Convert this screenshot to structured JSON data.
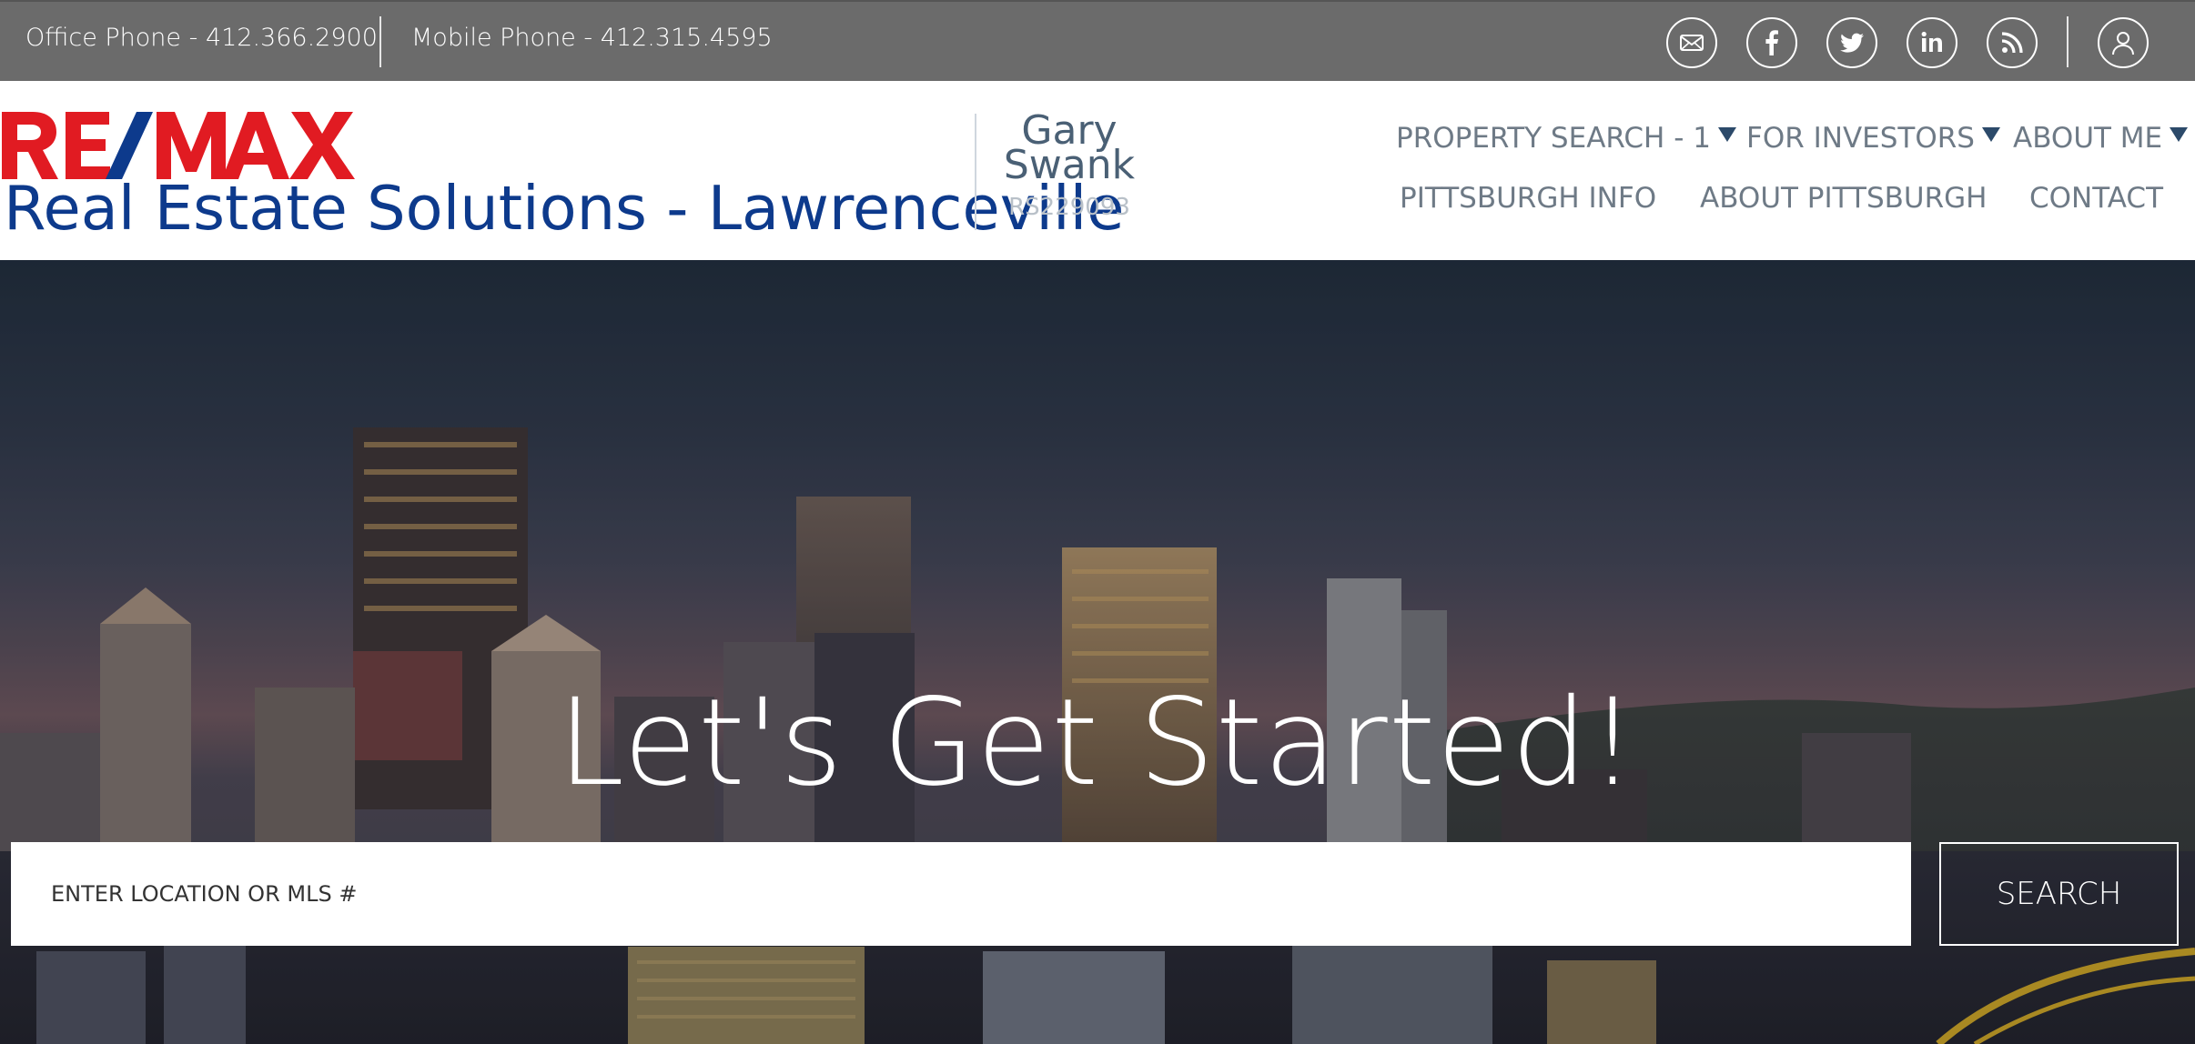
{
  "topbar": {
    "office_phone": "Office Phone - 412.366.2900",
    "mobile_phone": "Mobile Phone - 412.315.4595",
    "icons": [
      "email-icon",
      "facebook-icon",
      "twitter-icon",
      "linkedin-icon",
      "rss-icon",
      "user-icon"
    ]
  },
  "header": {
    "logo_text": "RE/MAX",
    "company_name": "Real Estate Solutions - Lawrenceville",
    "agent_first": "Gary",
    "agent_last": "Swank",
    "license": "RS229093"
  },
  "nav": {
    "property_search": "PROPERTY SEARCH - 1",
    "for_investors": "FOR INVESTORS",
    "about_me": "ABOUT ME",
    "pittsburgh_info": "PITTSBURGH INFO",
    "about_pittsburgh": "ABOUT PITTSBURGH",
    "contact": "CONTACT"
  },
  "hero": {
    "title": "Let's Get Started!",
    "search_placeholder": "ENTER LOCATION OR MLS #",
    "search_button": "SEARCH"
  },
  "colors": {
    "topbar": "#6b6b6b",
    "brand_red": "#e11b22",
    "brand_blue": "#0d3a8c",
    "nav_text": "#6e7a86"
  }
}
